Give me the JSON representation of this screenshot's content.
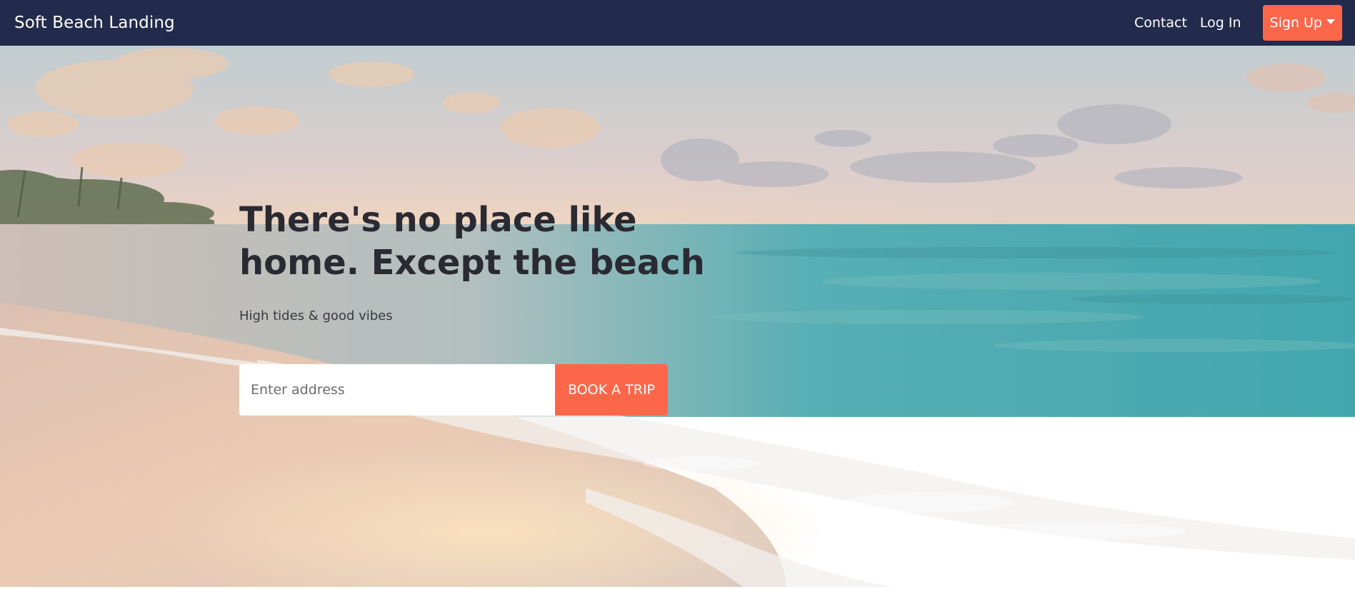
{
  "navbar": {
    "brand": "Soft Beach Landing",
    "links": {
      "contact": "Contact",
      "login": "Log In",
      "signup": "Sign Up"
    }
  },
  "hero": {
    "title_line1": "There's no place like",
    "title_line2": "home. Except the beach",
    "subtitle": "High tides & good vibes",
    "form": {
      "address_placeholder": "Enter address",
      "address_value": "",
      "book_label": "BOOK A TRIP"
    }
  },
  "colors": {
    "navbar_bg": "#232b4c",
    "accent": "#fd6749",
    "heading_text": "#2a2a33"
  },
  "icons": {
    "signup_dropdown": "caret-down-icon"
  }
}
